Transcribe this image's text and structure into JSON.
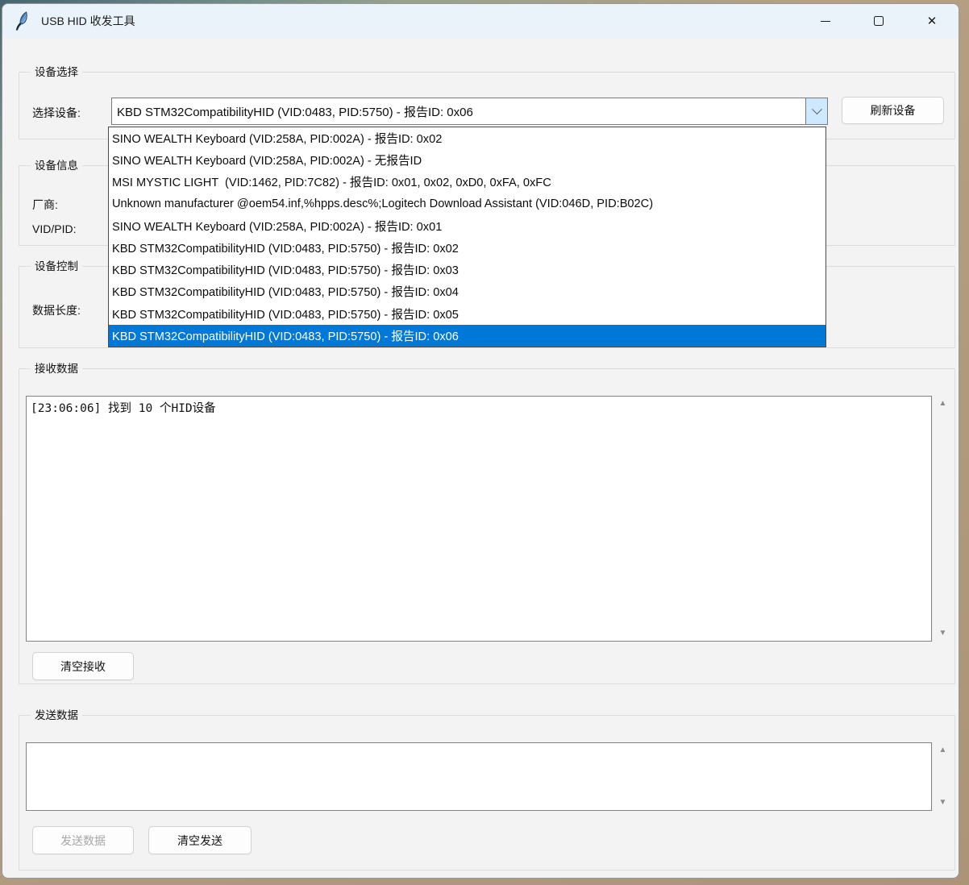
{
  "colors": {
    "accent": "#0078d7",
    "titlebar_bg": "#eaf3f9",
    "window_bg": "#f3f3f3",
    "combo_arrow_bg": "#cde8ff",
    "selected_text": "#ffffff"
  },
  "window": {
    "title": "USB HID 收发工具",
    "app_icon": "tk-feather-icon",
    "icons": {
      "minimize": "minimize-bar",
      "maximize": "square-outline",
      "close": "✕"
    }
  },
  "device_select": {
    "group_label": "设备选择",
    "field_label": "选择设备:",
    "combobox_value": "KBD STM32CompatibilityHID (VID:0483, PID:5750) - 报告ID: 0x06",
    "refresh_button": "刷新设备",
    "selected_index": 9,
    "dropdown_items": [
      "SINO WEALTH Keyboard (VID:258A, PID:002A) - 报告ID: 0x02",
      "SINO WEALTH Keyboard (VID:258A, PID:002A) - 无报告ID",
      "MSI MYSTIC LIGHT  (VID:1462, PID:7C82) - 报告ID: 0x01, 0x02, 0xD0, 0xFA, 0xFC",
      "Unknown manufacturer @oem54.inf,%hpps.desc%;Logitech Download Assistant (VID:046D, PID:B02C)",
      "SINO WEALTH Keyboard (VID:258A, PID:002A) - 报告ID: 0x01",
      "KBD STM32CompatibilityHID (VID:0483, PID:5750) - 报告ID: 0x02",
      "KBD STM32CompatibilityHID (VID:0483, PID:5750) - 报告ID: 0x03",
      "KBD STM32CompatibilityHID (VID:0483, PID:5750) - 报告ID: 0x04",
      "KBD STM32CompatibilityHID (VID:0483, PID:5750) - 报告ID: 0x05",
      "KBD STM32CompatibilityHID (VID:0483, PID:5750) - 报告ID: 0x06"
    ]
  },
  "device_info": {
    "group_label": "设备信息",
    "manufacturer_label": "厂商:",
    "vid_pid_label": "VID/PID:"
  },
  "device_control": {
    "group_label": "设备控制",
    "data_length_label": "数据长度:"
  },
  "receive": {
    "group_label": "接收数据",
    "content": "[23:06:06] 找到 10 个HID设备",
    "clear_button": "清空接收",
    "scroll_up_icon": "▲",
    "scroll_down_icon": "▼"
  },
  "send": {
    "group_label": "发送数据",
    "content": "",
    "send_button": "发送数据",
    "clear_button": "清空发送",
    "scroll_up_icon": "▲",
    "scroll_down_icon": "▼"
  }
}
